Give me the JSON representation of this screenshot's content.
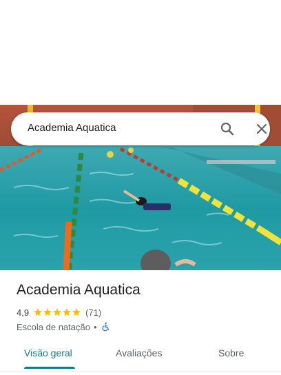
{
  "search": {
    "query": "Academia Aquatica"
  },
  "place": {
    "title": "Academia Aquatica",
    "rating": "4,9",
    "stars": 5,
    "review_count": "(71)",
    "category": "Escola de natação",
    "separator": "•",
    "accessibility_icon": "wheelchair-accessible-icon"
  },
  "tabs": [
    {
      "label": "Visão geral",
      "active": true
    },
    {
      "label": "Avaliações",
      "active": false
    },
    {
      "label": "Sobre",
      "active": false
    }
  ],
  "colors": {
    "accent": "#137b88",
    "star": "#fbbc04",
    "accessibility": "#1a73e8"
  }
}
